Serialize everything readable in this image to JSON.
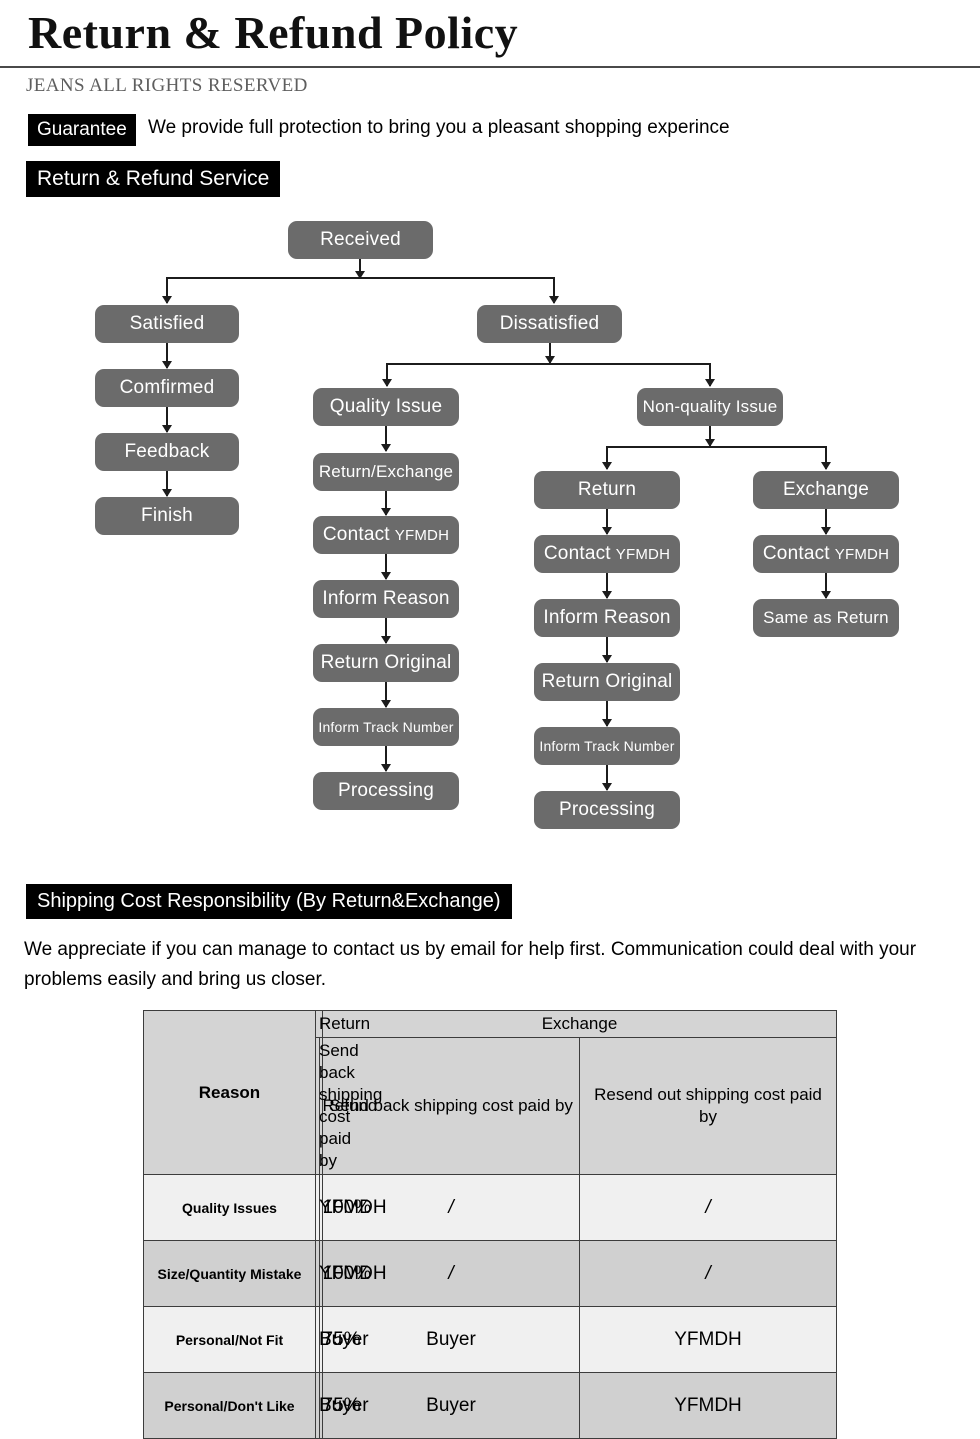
{
  "header": {
    "title": "Return & Refund Policy",
    "rights": "JEANS ALL RIGHTS RESERVED",
    "guarantee_tag": "Guarantee",
    "guarantee_text": "We provide full protection to bring you a pleasant shopping experince",
    "service_tag": "Return & Refund Service"
  },
  "flowchart": {
    "root": "Received",
    "branch_satisfied": "Satisfied",
    "branch_dissatisfied": "Dissatisfied",
    "satisfied_steps": [
      "Comfirmed",
      "Feedback",
      "Finish"
    ],
    "quality": {
      "title": "Quality Issue",
      "steps": [
        "Return/Exchange",
        "Contact",
        "Inform Reason",
        "Return Original",
        "Inform Track Number",
        "Processing"
      ],
      "contact_brand": "YFMDH"
    },
    "nonquality": {
      "title": "Non-quality Issue",
      "return": {
        "title": "Return",
        "steps": [
          "Contact",
          "Inform Reason",
          "Return Original",
          "Inform Track Number",
          "Processing"
        ],
        "contact_brand": "YFMDH"
      },
      "exchange": {
        "title": "Exchange",
        "steps": [
          "Contact",
          "Same as Return"
        ],
        "contact_brand": "YFMDH"
      }
    }
  },
  "shipping": {
    "tag": "Shipping Cost Responsibility (By Return&Exchange)",
    "note": "We appreciate if you can manage to contact us by email for help first. Communication could deal with your problems easily and bring us closer."
  },
  "cost_table": {
    "group_reason": "Reason",
    "group_return": "Return",
    "group_exchange": "Exchange",
    "sub_return_send": "Send back shipping cost paid by",
    "sub_refund": "Refund",
    "sub_exchange_send": "Send back shipping cost paid by",
    "sub_exchange_resend": "Resend out shipping cost paid by",
    "rows": [
      {
        "reason": "Quality Issues",
        "return_send": "YFMDH",
        "refund": "100%",
        "exchange_send": "/",
        "exchange_resend": "/"
      },
      {
        "reason": "Size/Quantity Mistake",
        "return_send": "YFMDH",
        "refund": "100%",
        "exchange_send": "/",
        "exchange_resend": "/"
      },
      {
        "reason": "Personal/Not Fit",
        "return_send": "Buyer",
        "refund": "75%",
        "exchange_send": "Buyer",
        "exchange_resend": "YFMDH"
      },
      {
        "reason": "Personal/Don't Like",
        "return_send": "Buyer",
        "refund": "75%",
        "exchange_send": "Buyer",
        "exchange_resend": "YFMDH"
      }
    ]
  },
  "colors": {
    "node_fill": "#6b6b6b",
    "node_text": "#ffffff",
    "tag_bg": "#000000",
    "connector": "#1c1c1c",
    "table_header_bg": "#d4d4d4",
    "table_row_odd": "#f0f0f0",
    "table_row_even": "#d0d0d0"
  }
}
